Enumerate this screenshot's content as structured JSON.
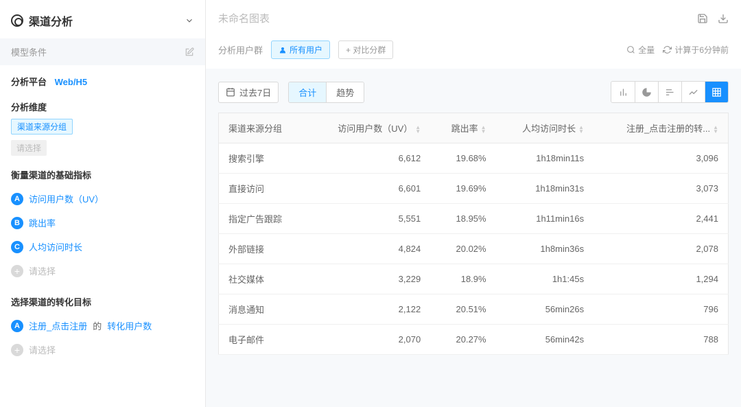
{
  "sidebar": {
    "title": "渠道分析",
    "model_label": "模型条件",
    "platform_section": {
      "label": "分析平台",
      "value": "Web/H5"
    },
    "dimension_section": {
      "label": "分析维度",
      "tag": "渠道来源分组",
      "placeholder": "请选择"
    },
    "metrics_section": {
      "label": "衡量渠道的基础指标",
      "items": [
        {
          "badge": "A",
          "label": "访问用户数（UV）"
        },
        {
          "badge": "B",
          "label": "跳出率"
        },
        {
          "badge": "C",
          "label": "人均访问时长"
        }
      ],
      "add_label": "请选择"
    },
    "conversion_section": {
      "label": "选择渠道的转化目标",
      "badge": "A",
      "tag": "注册_点击注册",
      "of_text": "的",
      "metric_tag": "转化用户数",
      "add_label": "请选择"
    }
  },
  "main": {
    "title": "未命名图表",
    "filter": {
      "group_label": "分析用户群",
      "all_users": "所有用户",
      "compare": "+ 对比分群",
      "full_label": "全量",
      "calc_label": "计算于6分钟前"
    },
    "toolbar": {
      "date_label": "过去7日",
      "tab_total": "合计",
      "tab_trend": "趋势"
    },
    "table": {
      "columns": [
        "渠道来源分组",
        "访问用户数（UV）",
        "跳出率",
        "人均访问时长",
        "注册_点击注册的转..."
      ],
      "rows": [
        {
          "name": "搜索引擎",
          "uv": "6,612",
          "bounce": "19.68%",
          "duration": "1h18min11s",
          "conv": "3,096"
        },
        {
          "name": "直接访问",
          "uv": "6,601",
          "bounce": "19.69%",
          "duration": "1h18min31s",
          "conv": "3,073"
        },
        {
          "name": "指定广告跟踪",
          "uv": "5,551",
          "bounce": "18.95%",
          "duration": "1h11min16s",
          "conv": "2,441"
        },
        {
          "name": "外部链接",
          "uv": "4,824",
          "bounce": "20.02%",
          "duration": "1h8min36s",
          "conv": "2,078"
        },
        {
          "name": "社交媒体",
          "uv": "3,229",
          "bounce": "18.9%",
          "duration": "1h1:45s",
          "conv": "1,294"
        },
        {
          "name": "消息通知",
          "uv": "2,122",
          "bounce": "20.51%",
          "duration": "56min26s",
          "conv": "796"
        },
        {
          "name": "电子邮件",
          "uv": "2,070",
          "bounce": "20.27%",
          "duration": "56min42s",
          "conv": "788"
        }
      ]
    }
  },
  "chart_data": {
    "type": "table",
    "columns": [
      "渠道来源分组",
      "访问用户数（UV）",
      "跳出率",
      "人均访问时长",
      "注册_点击注册转化"
    ],
    "rows": [
      [
        "搜索引擎",
        6612,
        "19.68%",
        "1h18min11s",
        3096
      ],
      [
        "直接访问",
        6601,
        "19.69%",
        "1h18min31s",
        3073
      ],
      [
        "指定广告跟踪",
        5551,
        "18.95%",
        "1h11min16s",
        2441
      ],
      [
        "外部链接",
        4824,
        "20.02%",
        "1h8min36s",
        2078
      ],
      [
        "社交媒体",
        3229,
        "18.9%",
        "1h1:45s",
        1294
      ],
      [
        "消息通知",
        2122,
        "20.51%",
        "56min26s",
        796
      ],
      [
        "电子邮件",
        2070,
        "20.27%",
        "56min42s",
        788
      ]
    ]
  }
}
